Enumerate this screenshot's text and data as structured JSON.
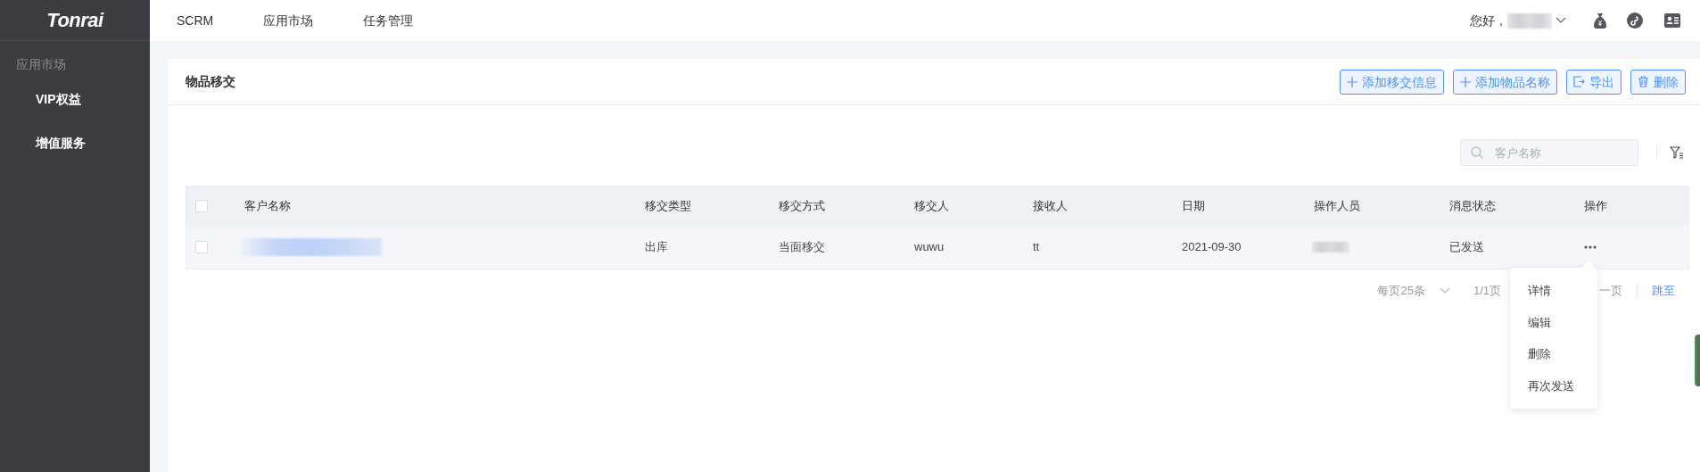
{
  "sidebar": {
    "logo": "Tonrai",
    "section": "应用市场",
    "items": [
      {
        "label": "VIP权益"
      },
      {
        "label": "增值服务"
      }
    ]
  },
  "topnav": {
    "items": [
      {
        "label": "SCRM"
      },
      {
        "label": "应用市场"
      },
      {
        "label": "任务管理"
      }
    ],
    "greeting": "您好，"
  },
  "card": {
    "title": "物品移交",
    "buttons": [
      {
        "label": "添加移交信息",
        "kind": "add"
      },
      {
        "label": "添加物品名称",
        "kind": "add"
      },
      {
        "label": "导出",
        "kind": "export"
      },
      {
        "label": "删除",
        "kind": "delete"
      }
    ]
  },
  "search": {
    "placeholder": "客户名称"
  },
  "table": {
    "header_checked": false,
    "columns": [
      "客户名称",
      "移交类型",
      "移交方式",
      "移交人",
      "接收人",
      "日期",
      "操作人员",
      "消息状态",
      "操作"
    ],
    "rows": [
      {
        "checked": false,
        "cells": [
          {
            "kind": "blurred"
          },
          {
            "kind": "text",
            "text": "出库"
          },
          {
            "kind": "text",
            "text": "当面移交"
          },
          {
            "kind": "text",
            "text": "wuwu"
          },
          {
            "kind": "text",
            "text": "tt"
          },
          {
            "kind": "text",
            "text": "2021-09-30"
          },
          {
            "kind": "blurred"
          },
          {
            "kind": "text",
            "text": "已发送"
          },
          {
            "kind": "more"
          }
        ]
      }
    ]
  },
  "pagination": {
    "page_size": "每页25条",
    "page": "1/1页",
    "next": "一页",
    "jump": "跳至"
  },
  "menu": {
    "items": [
      "详情",
      "编辑",
      "删除",
      "再次发送"
    ]
  }
}
